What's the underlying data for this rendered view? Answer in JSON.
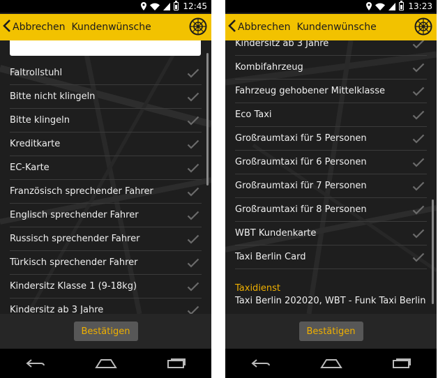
{
  "left": {
    "status": {
      "time": "12:45"
    },
    "appbar": {
      "back_label": "Abbrechen",
      "title": "Kundenwünsche"
    },
    "search": {
      "value": "",
      "placeholder": ""
    },
    "items": [
      {
        "label": "Faltrollstuhl"
      },
      {
        "label": "Bitte nicht klingeln"
      },
      {
        "label": "Bitte klingeln"
      },
      {
        "label": "Kreditkarte"
      },
      {
        "label": "EC-Karte"
      },
      {
        "label": "Französisch sprechender Fahrer"
      },
      {
        "label": "Englisch sprechender Fahrer"
      },
      {
        "label": "Russisch sprechender Fahrer"
      },
      {
        "label": "Türkisch sprechender Fahrer"
      },
      {
        "label": "Kindersitz Klasse 1 (9-18kg)"
      },
      {
        "label": "Kindersitz ab 3 Jahre"
      }
    ],
    "confirm_label": "Bestätigen"
  },
  "right": {
    "status": {
      "time": "13:23"
    },
    "appbar": {
      "back_label": "Abbrechen",
      "title": "Kundenwünsche"
    },
    "items": [
      {
        "label": "Kindersitz ab 3 Jahre"
      },
      {
        "label": "Kombifahrzeug"
      },
      {
        "label": "Fahrzeug gehobener Mittelklasse"
      },
      {
        "label": "Eco Taxi"
      },
      {
        "label": "Großraumtaxi für 5 Personen"
      },
      {
        "label": "Großraumtaxi für 6 Personen"
      },
      {
        "label": "Großraumtaxi für 7 Personen"
      },
      {
        "label": "Großraumtaxi für 8 Personen"
      },
      {
        "label": "WBT Kundenkarte"
      },
      {
        "label": "Taxi Berlin Card"
      }
    ],
    "section": {
      "title": "Taxidienst",
      "value": "Taxi Berlin 202020, WBT - Funk Taxi Berlin"
    },
    "confirm_label": "Bestätigen"
  },
  "icons": {
    "back": "chevron-left-icon",
    "check": "check-icon",
    "logo": "taxi-logo-icon",
    "nav_back": "back-arrow-icon",
    "nav_home": "home-icon",
    "nav_recents": "recents-icon"
  },
  "colors": {
    "appbar": "#f2c200",
    "accent_text": "#f0b000",
    "list_bg": "#1e1e1e",
    "button_bg": "#575757"
  }
}
